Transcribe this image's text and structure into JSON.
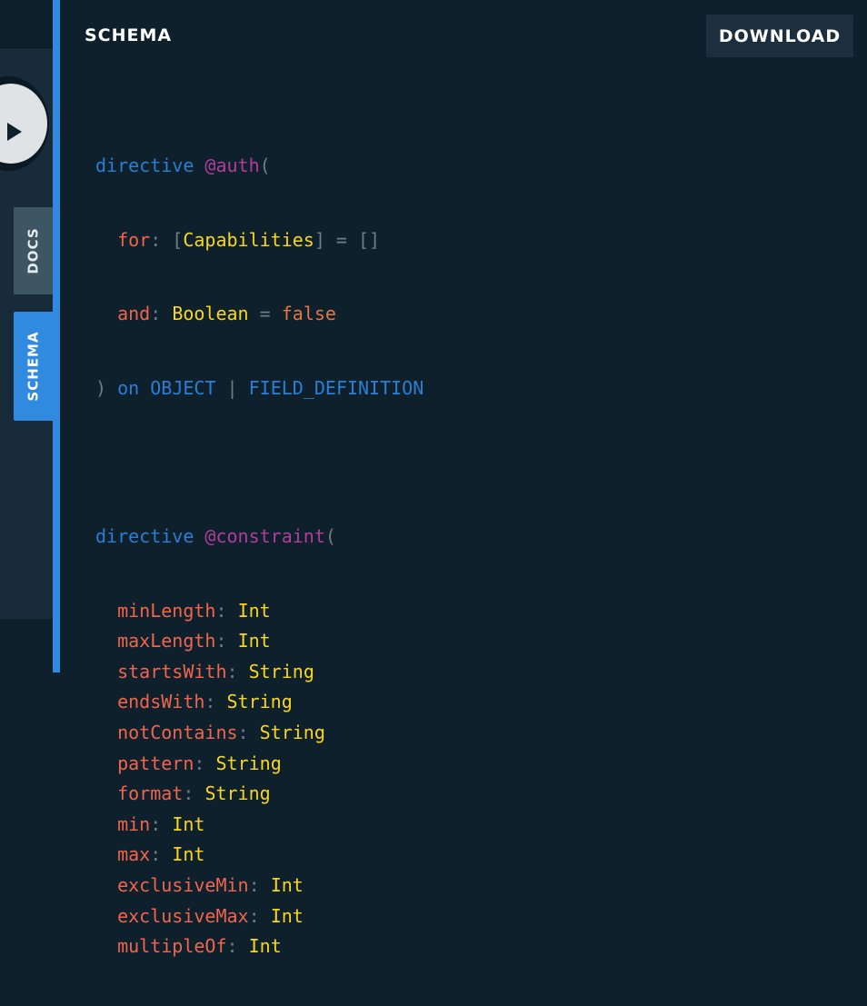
{
  "sidebar": {
    "tabs": [
      {
        "id": "docs",
        "label": "DOCS",
        "active": false
      },
      {
        "id": "schema",
        "label": "SCHEMA",
        "active": true
      }
    ]
  },
  "panel": {
    "title": "SCHEMA",
    "download_label": "DOWNLOAD"
  },
  "colors": {
    "accent": "#2f8ae0",
    "background": "#0f202d",
    "keyword": "#2a7ed3",
    "directive": "#b13d9b",
    "field": "#f0654b",
    "type": "#f8d61d",
    "default_value": "#e1783f",
    "punctuation": "#6d7d88"
  },
  "icons": {
    "play": "play-icon"
  },
  "schema": {
    "auth": {
      "keyword": "directive",
      "name": "@auth",
      "args": [
        {
          "name": "for",
          "type": "Capabilities",
          "list": true,
          "default": "[]"
        },
        {
          "name": "and",
          "type": "Boolean",
          "list": false,
          "default": "false"
        }
      ],
      "on_keyword": "on",
      "locations": [
        "OBJECT",
        "FIELD_DEFINITION"
      ]
    },
    "constraint": {
      "keyword": "directive",
      "name": "@constraint",
      "args": [
        {
          "name": "minLength",
          "type": "Int"
        },
        {
          "name": "maxLength",
          "type": "Int"
        },
        {
          "name": "startsWith",
          "type": "String"
        },
        {
          "name": "endsWith",
          "type": "String"
        },
        {
          "name": "notContains",
          "type": "String"
        },
        {
          "name": "pattern",
          "type": "String"
        },
        {
          "name": "format",
          "type": "String"
        },
        {
          "name": "min",
          "type": "Int"
        },
        {
          "name": "max",
          "type": "Int"
        },
        {
          "name": "exclusiveMin",
          "type": "Int"
        },
        {
          "name": "exclusiveMax",
          "type": "Int"
        },
        {
          "name": "multipleOf",
          "type": "Int"
        }
      ]
    }
  }
}
